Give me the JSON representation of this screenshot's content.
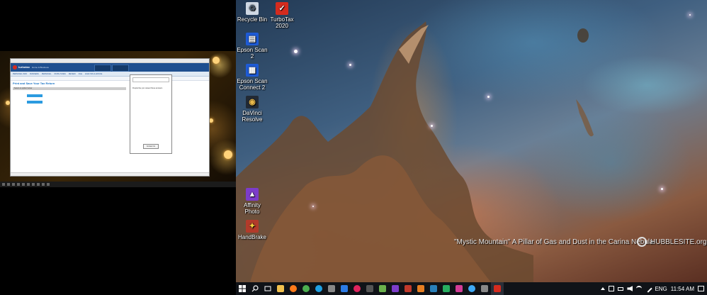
{
  "left_screen": {
    "turbotax_window": {
      "logo": "turbotax",
      "edition": "Home & Business",
      "nav_tabs": [
        "PERSONAL INFO",
        "BUSINESS",
        "PERSONAL",
        "STATE TAXES",
        "REVIEW",
        "FILE",
        "ANALYSIS & ADVICE"
      ],
      "page_title": "Print and Save Your Tax Return",
      "section_bar": "Select an option below",
      "help_panel_heading": "People like you viewed these answers",
      "contact_button": "Contact Us"
    }
  },
  "desktop": {
    "icons": [
      {
        "label": "Recycle Bin",
        "icon": "recycle-bin-icon",
        "color": "#cfd8e3"
      },
      {
        "label": "TurboTax 2020",
        "icon": "turbotax-icon",
        "color": "#d52b1e"
      },
      {
        "label": "Epson Scan 2",
        "icon": "epson-scan-icon",
        "color": "#1e5bd6"
      },
      {
        "label": "Epson Scan Connect 2",
        "icon": "epson-connect-icon",
        "color": "#1e5bd6"
      },
      {
        "label": "DaVinci Resolve",
        "icon": "davinci-resolve-icon",
        "color": "#222a35"
      },
      {
        "label": "Affinity Photo",
        "icon": "affinity-photo-icon",
        "color": "#7c3cc9"
      },
      {
        "label": "HandBrake",
        "icon": "handbrake-icon",
        "color": "#b33a2a"
      }
    ],
    "wallpaper_caption": "\"Mystic Mountain\" A Pillar of Gas and Dust in the Carina Nebula",
    "wallpaper_brand": "HUBBLESITE.org"
  },
  "taskbar": {
    "apps": [
      {
        "name": "start-button",
        "color": "#3a8ee6"
      },
      {
        "name": "search-icon",
        "color": "#ffffff"
      },
      {
        "name": "task-view-icon",
        "color": "#ffffff"
      },
      {
        "name": "file-explorer-icon",
        "color": "#f2c14e"
      },
      {
        "name": "firefox-icon",
        "color": "#ff7a1a"
      },
      {
        "name": "chrome-icon",
        "color": "#4caf50"
      },
      {
        "name": "edge-icon",
        "color": "#1fa0e3"
      },
      {
        "name": "dvd-icon",
        "color": "#888888"
      },
      {
        "name": "media-app-icon",
        "color": "#2c7be5"
      },
      {
        "name": "quicken-icon",
        "color": "#e0245e"
      },
      {
        "name": "app-dark-icon",
        "color": "#555555"
      },
      {
        "name": "notepad-icon",
        "color": "#6ab04c"
      },
      {
        "name": "affinity-photo-icon",
        "color": "#7c3cc9"
      },
      {
        "name": "app-red-icon",
        "color": "#c0392b"
      },
      {
        "name": "app-orange-icon",
        "color": "#e67e22"
      },
      {
        "name": "app-blue-icon",
        "color": "#2980b9"
      },
      {
        "name": "app-green-icon",
        "color": "#27ae60"
      },
      {
        "name": "app-magenta-icon",
        "color": "#d23c96"
      },
      {
        "name": "app-skyblue-icon",
        "color": "#3fa9f5"
      },
      {
        "name": "app-gray-icon",
        "color": "#888888"
      },
      {
        "name": "turbotax-icon",
        "color": "#d52b1e"
      }
    ],
    "tray": {
      "language": "ENG",
      "time": "11:54 AM"
    }
  }
}
